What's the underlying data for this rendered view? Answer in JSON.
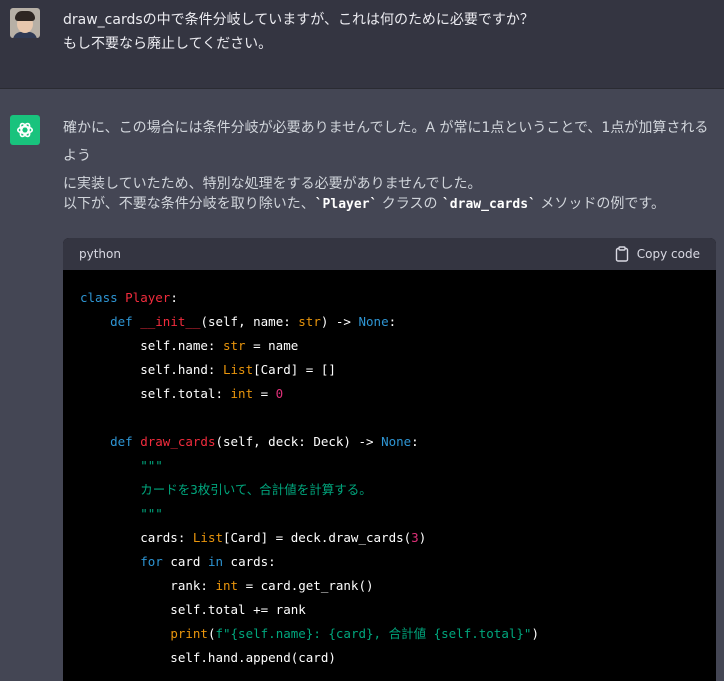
{
  "user_message": {
    "line1": "draw_cardsの中で条件分岐していますが、これは何のために必要ですか？",
    "line2": "もし不要なら廃止してください。"
  },
  "assistant_message": {
    "p1_line1": "確かに、この場合には条件分岐が必要ありませんでした。A が常に1点ということで、1点が加算されるよう",
    "p1_line2": "に実装していたため、特別な処理をする必要がありませんでした。",
    "p2_before": "以下が、不要な条件分岐を取り除いた、",
    "p2_code1": "`Player`",
    "p2_middle": " クラスの ",
    "p2_code2": "`draw_cards`",
    "p2_after": " メソッドの例です。"
  },
  "code_block": {
    "language": "python",
    "copy_label": "Copy code",
    "lines": [
      [
        {
          "t": "class ",
          "c": "kw"
        },
        {
          "t": "Player",
          "c": "cls"
        },
        {
          "t": ":",
          "c": ""
        }
      ],
      [
        {
          "t": "    ",
          "c": ""
        },
        {
          "t": "def ",
          "c": "kw"
        },
        {
          "t": "__init__",
          "c": "cls"
        },
        {
          "t": "(self, name: ",
          "c": ""
        },
        {
          "t": "str",
          "c": "bi"
        },
        {
          "t": ") -> ",
          "c": ""
        },
        {
          "t": "None",
          "c": "kw"
        },
        {
          "t": ":",
          "c": ""
        }
      ],
      [
        {
          "t": "        self.name: ",
          "c": ""
        },
        {
          "t": "str",
          "c": "bi"
        },
        {
          "t": " = name",
          "c": ""
        }
      ],
      [
        {
          "t": "        self.hand: ",
          "c": ""
        },
        {
          "t": "List",
          "c": "bi"
        },
        {
          "t": "[Card] = []",
          "c": ""
        }
      ],
      [
        {
          "t": "        self.total: ",
          "c": ""
        },
        {
          "t": "int",
          "c": "bi"
        },
        {
          "t": " = ",
          "c": ""
        },
        {
          "t": "0",
          "c": "num"
        }
      ],
      [
        {
          "t": "",
          "c": ""
        }
      ],
      [
        {
          "t": "    ",
          "c": ""
        },
        {
          "t": "def ",
          "c": "kw"
        },
        {
          "t": "draw_cards",
          "c": "cls"
        },
        {
          "t": "(self, deck: Deck) -> ",
          "c": ""
        },
        {
          "t": "None",
          "c": "kw"
        },
        {
          "t": ":",
          "c": ""
        }
      ],
      [
        {
          "t": "        \"\"\"",
          "c": "str"
        }
      ],
      [
        {
          "t": "        カードを3枚引いて、合計値を計算する。",
          "c": "str"
        }
      ],
      [
        {
          "t": "        \"\"\"",
          "c": "str"
        }
      ],
      [
        {
          "t": "        cards: ",
          "c": ""
        },
        {
          "t": "List",
          "c": "bi"
        },
        {
          "t": "[Card] = deck.draw_cards(",
          "c": ""
        },
        {
          "t": "3",
          "c": "num"
        },
        {
          "t": ")",
          "c": ""
        }
      ],
      [
        {
          "t": "        ",
          "c": ""
        },
        {
          "t": "for",
          "c": "kw"
        },
        {
          "t": " card ",
          "c": ""
        },
        {
          "t": "in",
          "c": "kw"
        },
        {
          "t": " cards:",
          "c": ""
        }
      ],
      [
        {
          "t": "            rank: ",
          "c": ""
        },
        {
          "t": "int",
          "c": "bi"
        },
        {
          "t": " = card.get_rank()",
          "c": ""
        }
      ],
      [
        {
          "t": "            self.total += rank",
          "c": ""
        }
      ],
      [
        {
          "t": "            ",
          "c": ""
        },
        {
          "t": "print",
          "c": "bi"
        },
        {
          "t": "(",
          "c": ""
        },
        {
          "t": "f\"{self.name}: {card}, 合計値 {self.total}\"",
          "c": "str"
        },
        {
          "t": ")",
          "c": ""
        }
      ],
      [
        {
          "t": "            self.hand.append(card)",
          "c": ""
        }
      ]
    ]
  }
}
